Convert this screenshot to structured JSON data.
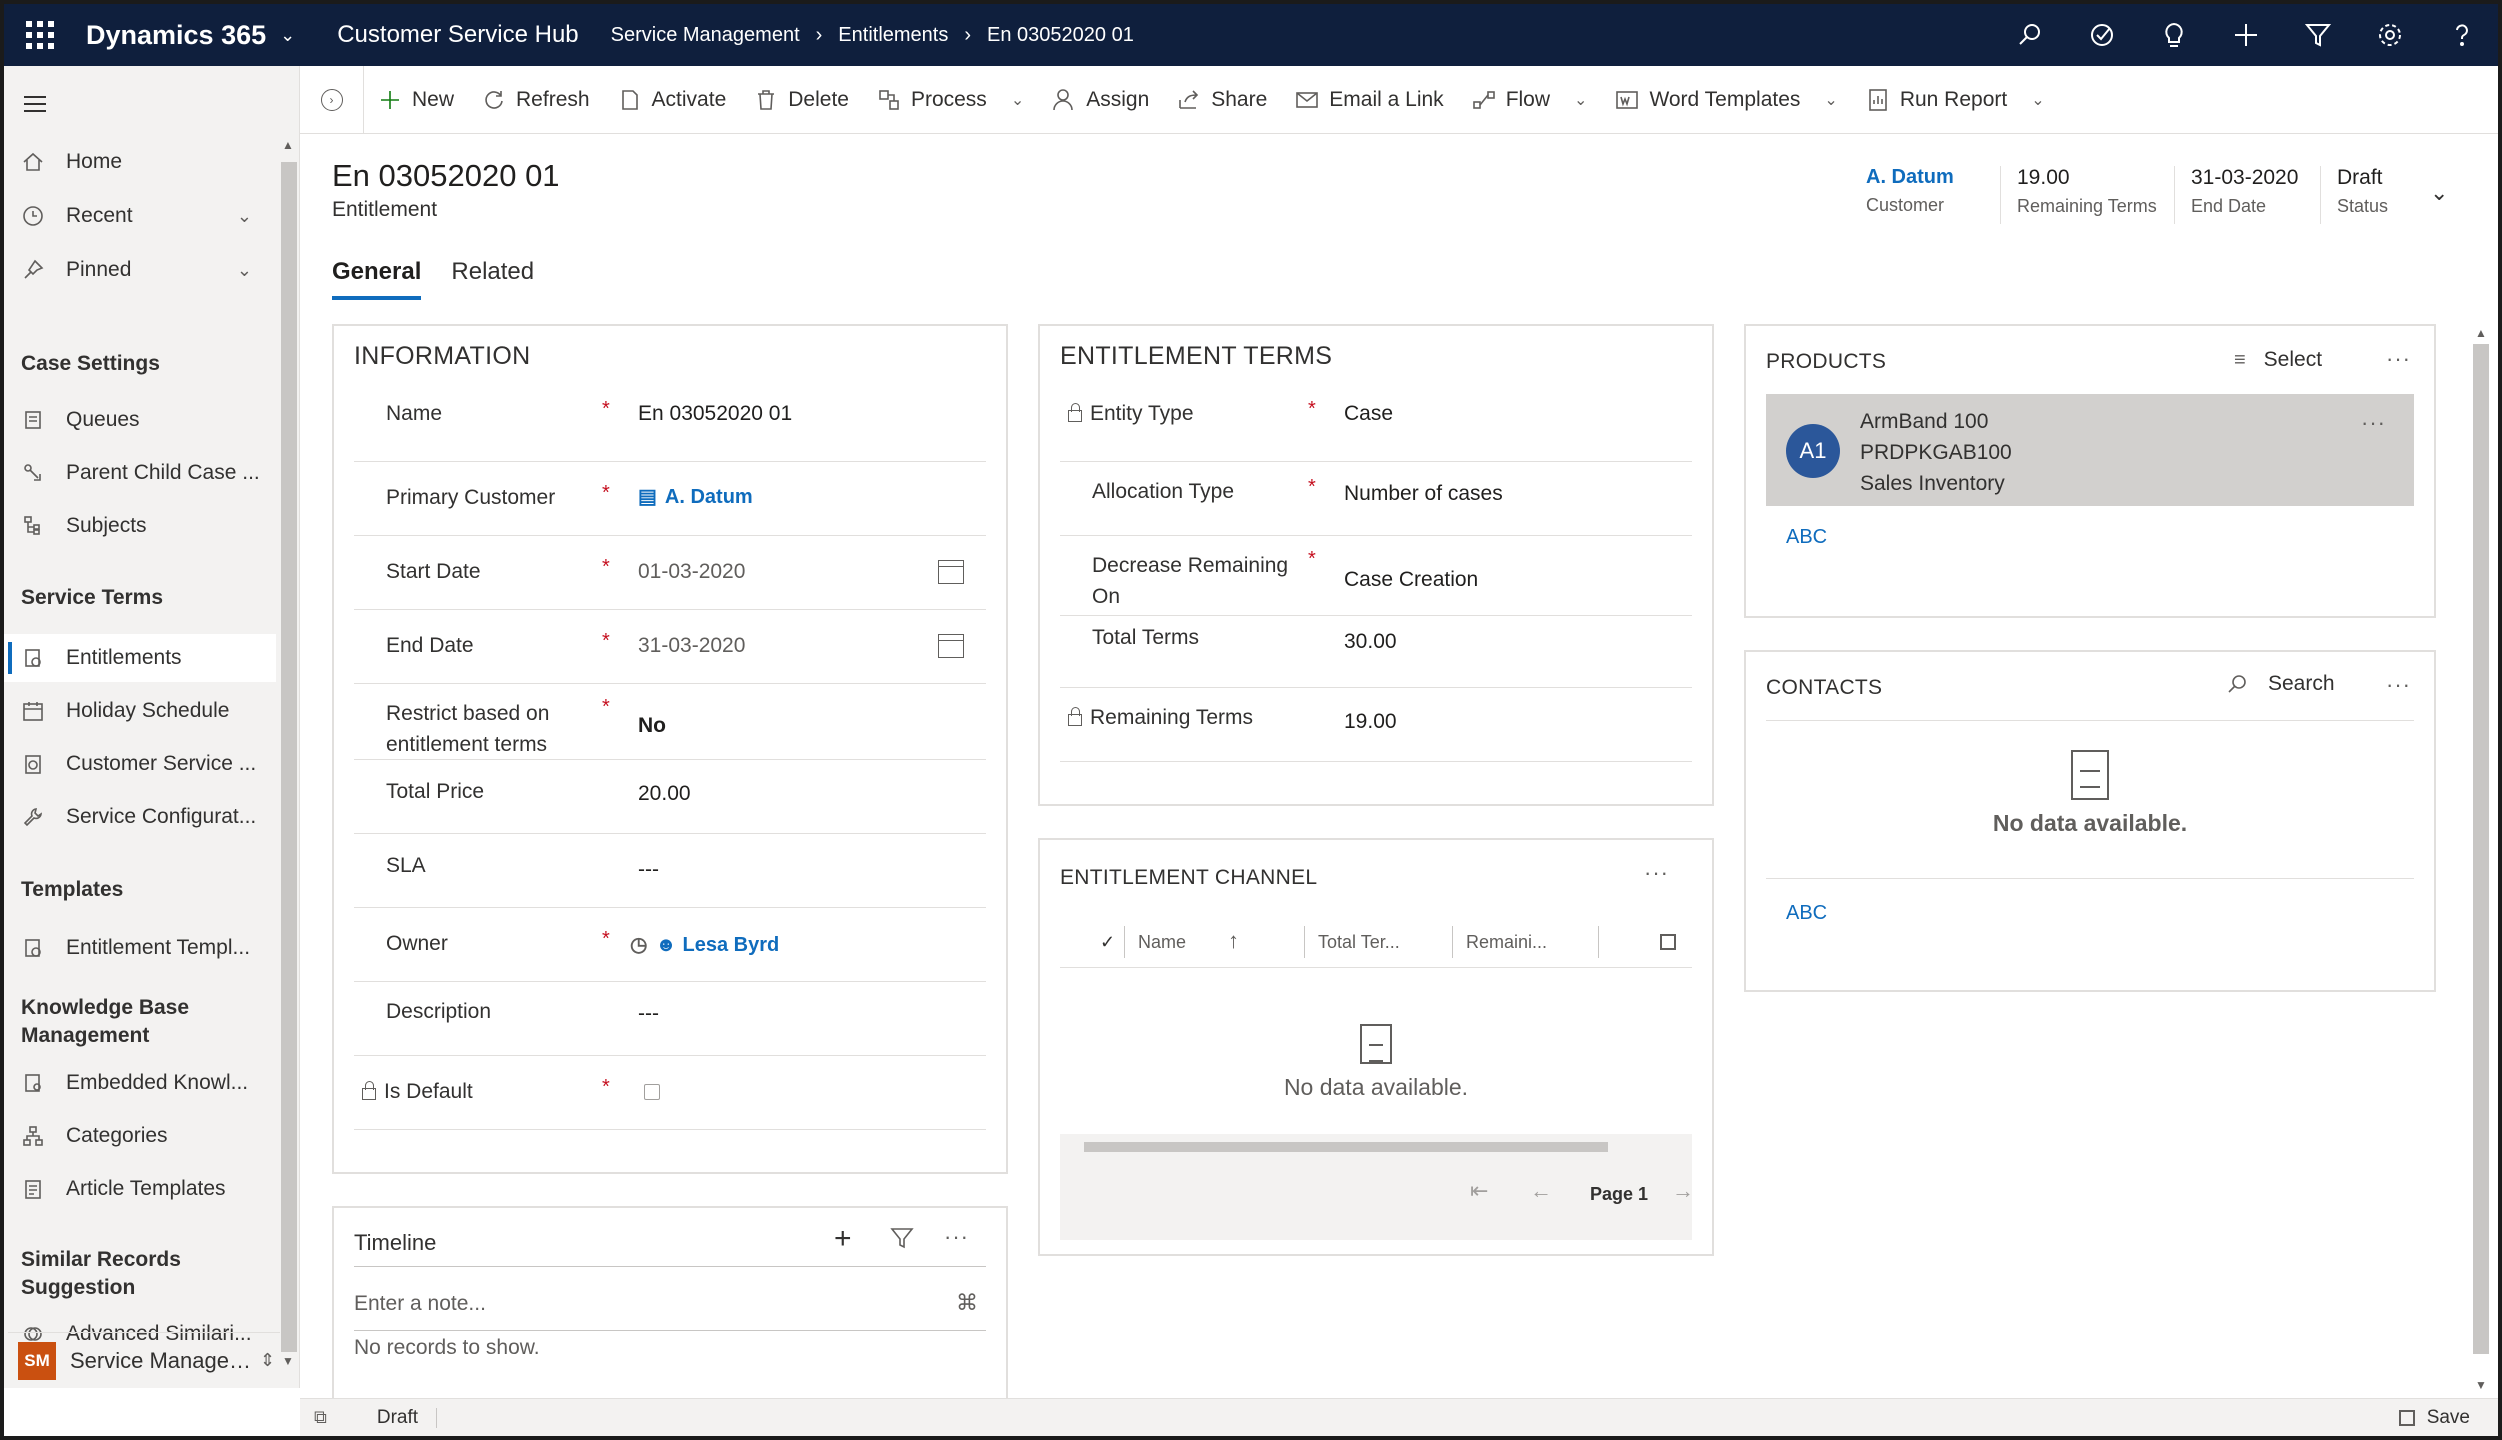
{
  "topbar": {
    "app_name": "Dynamics 365",
    "hub_name": "Customer Service Hub",
    "breadcrumb": [
      "Service Management",
      "Entitlements",
      "En 03052020 01"
    ],
    "icons": [
      "search-icon",
      "task-icon",
      "lightbulb-icon",
      "plus-icon",
      "filter-icon",
      "settings-icon",
      "help-icon"
    ]
  },
  "sidebar": {
    "items_top": [
      {
        "label": "Home",
        "icon": "home-icon"
      },
      {
        "label": "Recent",
        "icon": "clock-icon"
      },
      {
        "label": "Pinned",
        "icon": "pin-icon"
      }
    ],
    "groups": [
      {
        "title": "Case Settings",
        "items": [
          "Queues",
          "Parent Child Case ...",
          "Subjects"
        ]
      },
      {
        "title": "Service Terms",
        "items": [
          "Entitlements",
          "Holiday Schedule",
          "Customer Service ...",
          "Service Configurat..."
        ]
      },
      {
        "title": "Templates",
        "items": [
          "Entitlement Templ..."
        ]
      },
      {
        "title": "Knowledge Base Management",
        "items": [
          "Embedded Knowl...",
          "Categories",
          "Article Templates"
        ]
      },
      {
        "title": "Similar Records Suggestion",
        "items": [
          "Advanced Similari..."
        ]
      }
    ],
    "active_item": "Entitlements",
    "area": {
      "badge": "SM",
      "label": "Service Managem..."
    }
  },
  "commands": [
    "New",
    "Refresh",
    "Activate",
    "Delete",
    "Process",
    "Assign",
    "Share",
    "Email a Link",
    "Flow",
    "Word Templates",
    "Run Report"
  ],
  "record": {
    "title": "En 03052020 01",
    "entity": "Entitlement",
    "header_fields": [
      {
        "value": "A. Datum",
        "label": "Customer"
      },
      {
        "value": "19.00",
        "label": "Remaining Terms"
      },
      {
        "value": "31-03-2020",
        "label": "End Date"
      },
      {
        "value": "Draft",
        "label": "Status"
      }
    ],
    "tabs": [
      "General",
      "Related"
    ]
  },
  "information": {
    "title": "INFORMATION",
    "fields": [
      {
        "label": "Name",
        "value": "En 03052020 01",
        "required": true
      },
      {
        "label": "Primary Customer",
        "value": "A. Datum",
        "required": true
      },
      {
        "label": "Start Date",
        "value": "01-03-2020",
        "required": true
      },
      {
        "label": "End Date",
        "value": "31-03-2020",
        "required": true
      },
      {
        "label": "Restrict based on entitlement terms",
        "value": "No",
        "required": true
      },
      {
        "label": "Total Price",
        "value": "20.00",
        "required": false
      },
      {
        "label": "SLA",
        "value": "---",
        "required": false
      },
      {
        "label": "Owner",
        "value": "Lesa Byrd",
        "required": true
      },
      {
        "label": "Description",
        "value": "---",
        "required": false
      },
      {
        "label": "Is Default",
        "value": "",
        "required": true
      }
    ]
  },
  "terms": {
    "title": "ENTITLEMENT TERMS",
    "fields": [
      {
        "label": "Entity Type",
        "value": "Case",
        "required": true
      },
      {
        "label": "Allocation Type",
        "value": "Number of cases",
        "required": true
      },
      {
        "label": "Decrease Remaining On",
        "value": "Case Creation",
        "required": true
      },
      {
        "label": "Total Terms",
        "value": "30.00",
        "required": false
      },
      {
        "label": "Remaining Terms",
        "value": "19.00",
        "required": false
      }
    ]
  },
  "channel": {
    "title": "ENTITLEMENT CHANNEL",
    "columns": [
      "Name",
      "Total Ter...",
      "Remaini..."
    ],
    "empty": "No data available.",
    "page": "Page 1"
  },
  "timeline": {
    "title": "Timeline",
    "placeholder": "Enter a note...",
    "empty": "No records to show."
  },
  "products": {
    "title": "PRODUCTS",
    "select_label": "Select",
    "item": {
      "initials": "A1",
      "name": "ArmBand 100",
      "code": "PRDPKGAB100",
      "type": "Sales Inventory"
    },
    "footer": "ABC"
  },
  "contacts": {
    "title": "CONTACTS",
    "search_label": "Search",
    "empty": "No data available.",
    "footer": "ABC"
  },
  "statusbar": {
    "status": "Draft",
    "save": "Save"
  },
  "colors": {
    "topbar": "#0f1f3d",
    "accent": "#0f6cbd",
    "required": "#c50f1f",
    "area_badge": "#ca5010",
    "avatar": "#2b579a"
  }
}
